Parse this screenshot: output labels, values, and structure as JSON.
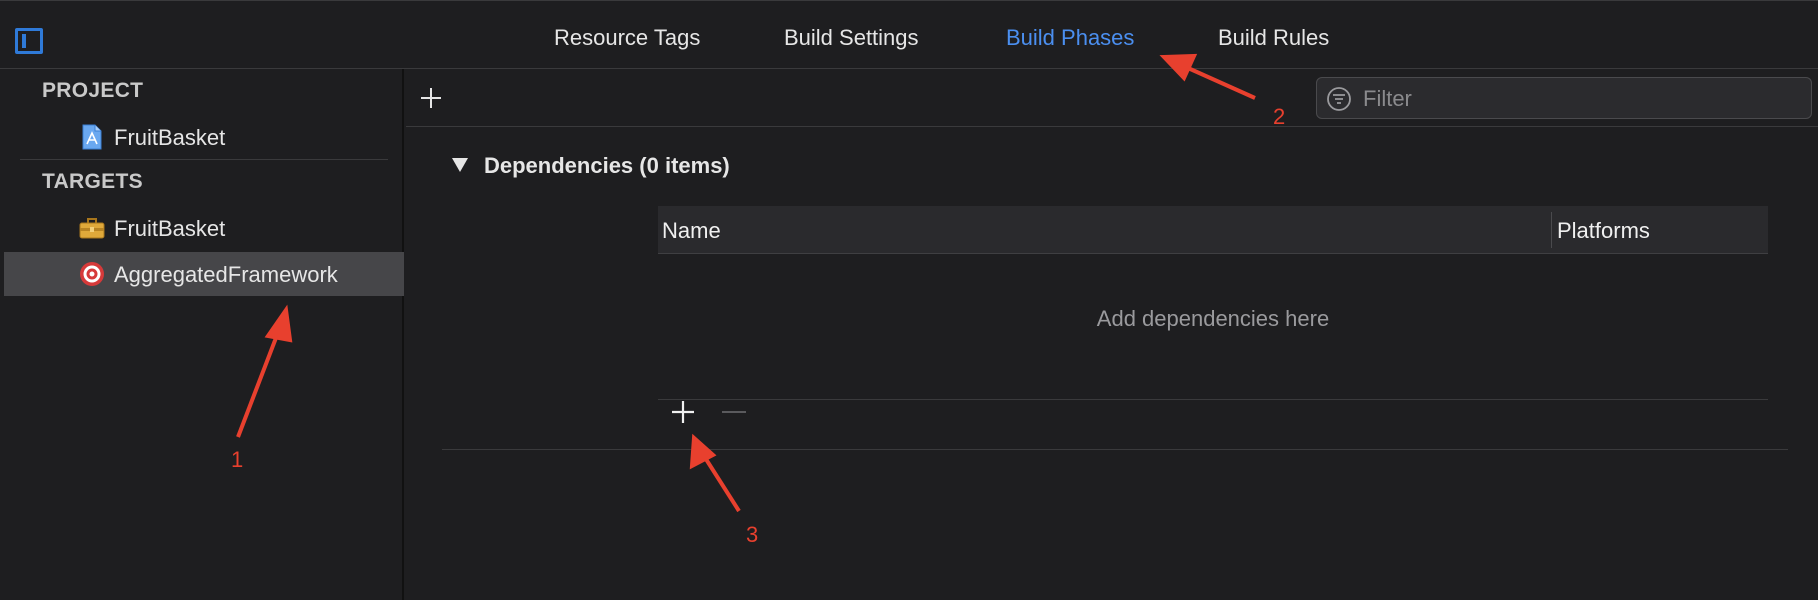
{
  "tabs": [
    {
      "label": "Resource Tags"
    },
    {
      "label": "Build Settings"
    },
    {
      "label": "Build Phases",
      "active": true
    },
    {
      "label": "Build Rules"
    }
  ],
  "sidebar": {
    "project_header": "PROJECT",
    "project_items": [
      {
        "label": "FruitBasket",
        "icon": "project-file-icon"
      }
    ],
    "targets_header": "TARGETS",
    "target_items": [
      {
        "label": "FruitBasket",
        "icon": "toolbox-icon"
      },
      {
        "label": "AggregatedFramework",
        "icon": "target-icon",
        "selected": true
      }
    ]
  },
  "toolbar": {
    "filter_placeholder": "Filter"
  },
  "phase": {
    "title": "Dependencies (0 items)",
    "columns": [
      "Name",
      "Platforms"
    ],
    "empty_text": "Add dependencies here"
  },
  "annotations": [
    "1",
    "2",
    "3"
  ],
  "colors": {
    "accent": "#4b8ff0",
    "annotation": "#e8402e",
    "background": "#1e1e20",
    "selection": "#464649"
  }
}
